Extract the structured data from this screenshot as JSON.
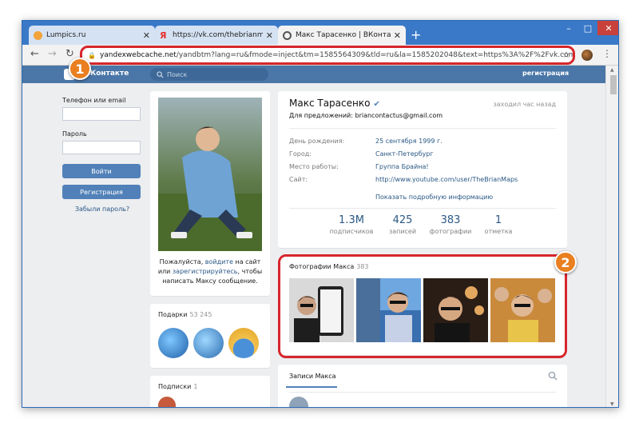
{
  "browser": {
    "tabs": [
      {
        "title": "Lumpics.ru",
        "active": false
      },
      {
        "title": "https://vk.com/thebrianmaps site",
        "active": false
      },
      {
        "title": "Макс Тарасенко | ВКонтакте",
        "active": true
      }
    ],
    "new_tab": "+",
    "url_host": "yandexwebcache.net",
    "url_rest": "/yandbtm?lang=ru&fmode=inject&tm=1585564309&tld=ru&la=1585202048&text=https%3A%2F%2Fvk.com%2Fthe...",
    "window_controls": {
      "min": "–",
      "max": "□",
      "close": "✕"
    }
  },
  "annotations": [
    {
      "label": "1"
    },
    {
      "label": "2"
    }
  ],
  "vk": {
    "brand": "ВКонтакте",
    "search_placeholder": "Поиск",
    "register_link": "регистрация",
    "login": {
      "phone_label": "Телефон или email",
      "password_label": "Пароль",
      "login_button": "Войти",
      "register_button": "Регистрация",
      "forgot_link": "Забыли пароль?"
    },
    "avatar_message": {
      "before": "Пожалуйста, ",
      "login_link": "войдите",
      "mid": " на сайт или ",
      "register_link": "зарегистрируйтесь",
      "after": ", чтобы написать Максу сообщение."
    },
    "gifts": {
      "title": "Подарки",
      "count": "53 245"
    },
    "subscriptions": {
      "title": "Подписки",
      "count": "1"
    },
    "profile": {
      "name": "Макс Тарасенко",
      "status": "Для предложений: briancontactus@gmail.com",
      "online": "заходил час назад",
      "info": [
        {
          "key": "День рождения:",
          "value": "25 сентября 1999 г."
        },
        {
          "key": "Город:",
          "value": "Санкт-Петербург"
        },
        {
          "key": "Место работы:",
          "value": "Группа Брайна!"
        },
        {
          "key": "Сайт:",
          "value": "http://www.youtube.com/user/TheBrianMaps"
        }
      ],
      "show_more": "Показать подробную информацию",
      "counters": [
        {
          "num": "1.3M",
          "label": "подписчиков"
        },
        {
          "num": "425",
          "label": "записей"
        },
        {
          "num": "383",
          "label": "фотографии"
        },
        {
          "num": "1",
          "label": "отметка"
        }
      ]
    },
    "photos": {
      "title": "Фотографии Макса",
      "count": "383"
    },
    "wall": {
      "title": "Записи Макса"
    }
  },
  "colors": {
    "vk_blue": "#4a76a8",
    "vk_button": "#5181b8",
    "link": "#2a5885",
    "annotation": "#d6262c",
    "badge": "#e97f20",
    "chrome_frame": "#3a79c8"
  },
  "icons": {
    "back": "arrow-left-icon",
    "forward": "arrow-right-icon",
    "reload": "reload-icon",
    "lock": "lock-icon",
    "star": "star-icon",
    "menu": "kebab-menu-icon",
    "search": "search-icon"
  }
}
